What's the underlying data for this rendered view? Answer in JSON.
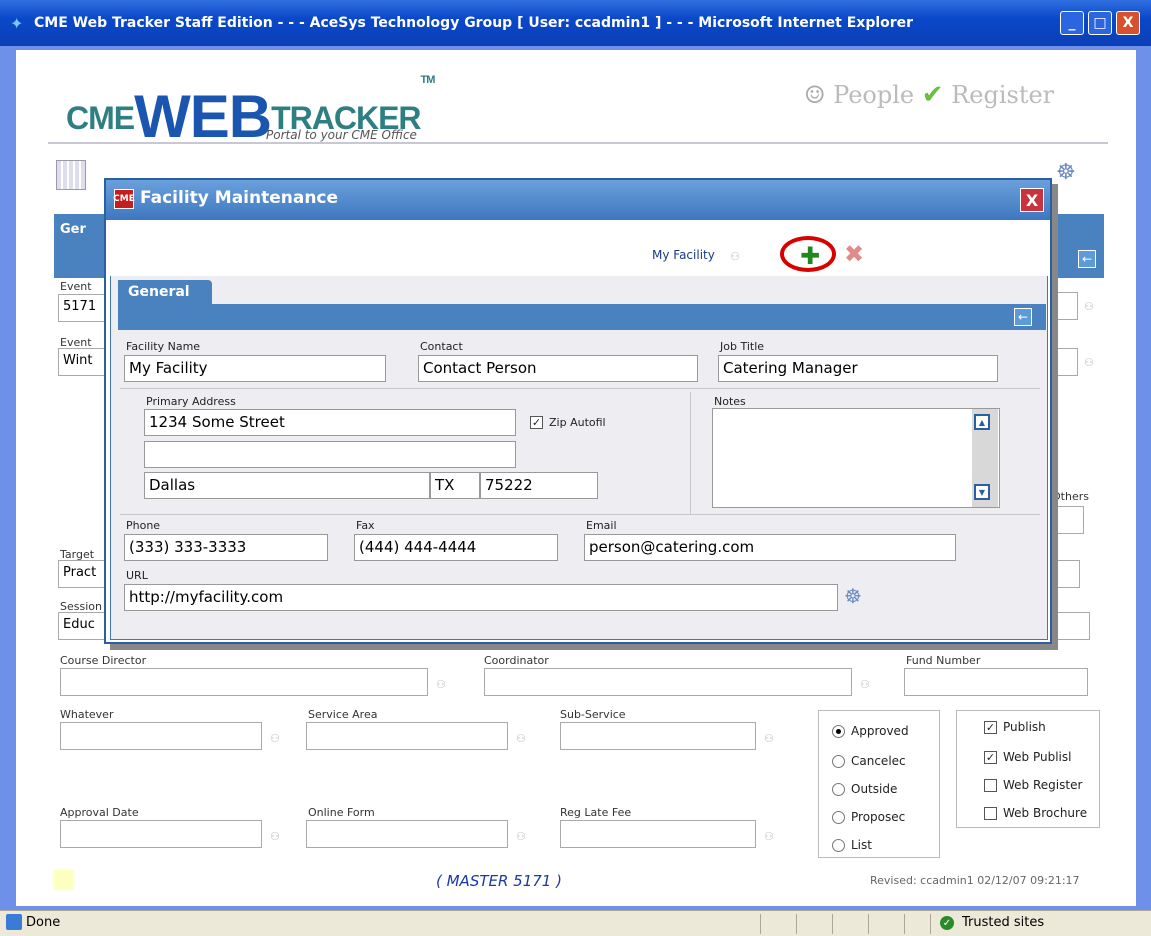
{
  "window": {
    "title": "CME Web Tracker Staff Edition - - - AceSys Technology Group [ User: ccadmin1 ] - - - Microsoft Internet Explorer",
    "min": "_",
    "max": "□",
    "close": "X"
  },
  "header": {
    "logo_cme": "CME",
    "logo_web": "WEB",
    "logo_tracker": "TRACKER",
    "logo_tm": "TM",
    "tagline": "Portal to your CME Office",
    "link_people": "People",
    "link_register": "Register"
  },
  "background": {
    "tab_label": "Ger",
    "labels": {
      "event_id": "Event",
      "event_name": "Event",
      "target": "Target",
      "session": "Session",
      "course_director": "Course Director",
      "coordinator": "Coordinator",
      "fund_number": "Fund Number",
      "whatever": "Whatever",
      "service_area": "Service Area",
      "sub_service": "Sub-Service",
      "approval_date": "Approval Date",
      "online_form": "Online Form",
      "reg_late_fee": "Reg Late Fee",
      "others": "Others"
    },
    "values": {
      "event_id": "5171",
      "event_name": "Wint",
      "target": "Pract",
      "session": "Educ"
    },
    "status_options": [
      {
        "label": "Approved",
        "checked": true
      },
      {
        "label": "Cancelec",
        "checked": false
      },
      {
        "label": "Outside",
        "checked": false
      },
      {
        "label": "Proposec",
        "checked": false
      },
      {
        "label": "List",
        "checked": false
      }
    ],
    "web_options": [
      {
        "label": "Publish",
        "checked": true
      },
      {
        "label": "Web Publisl",
        "checked": true
      },
      {
        "label": "Web Register",
        "checked": false
      },
      {
        "label": "Web Brochure",
        "checked": false
      }
    ],
    "footer_master": "( MASTER   5171 )",
    "footer_revised": "Revised: ccadmin1 02/12/07 09:21:17"
  },
  "modal": {
    "title": "Facility Maintenance",
    "logo": "CME",
    "close": "X",
    "record_name": "My Facility",
    "tab": "General",
    "fields": {
      "facility_name": {
        "label": "Facility Name",
        "value": "My Facility"
      },
      "contact": {
        "label": "Contact",
        "value": "Contact Person"
      },
      "job_title": {
        "label": "Job Title",
        "value": "Catering Manager"
      },
      "primary_address": {
        "label": "Primary Address",
        "line1": "1234 Some Street",
        "line2": "",
        "city": "Dallas",
        "state": "TX",
        "zip": "75222"
      },
      "zip_autofill": {
        "label": "Zip Autofil",
        "checked": true
      },
      "notes": {
        "label": "Notes",
        "value": ""
      },
      "phone": {
        "label": "Phone",
        "value": "(333) 333-3333"
      },
      "fax": {
        "label": "Fax",
        "value": "(444) 444-4444"
      },
      "email": {
        "label": "Email",
        "value": "person@catering.com"
      },
      "url": {
        "label": "URL",
        "value": "http://myfacility.com"
      }
    }
  },
  "statusbar": {
    "done": "Done",
    "zone": "Trusted sites"
  },
  "icons": {
    "add": "plus-icon",
    "delete": "x-icon",
    "binoculars": "binoculars-icon",
    "back": "back-arrow-icon",
    "globe": "web-link-icon"
  },
  "colors": {
    "titlebar": "#0a48c9",
    "tab": "#4a82c0",
    "highlight": "#d80000",
    "add": "#1e8a1e"
  }
}
